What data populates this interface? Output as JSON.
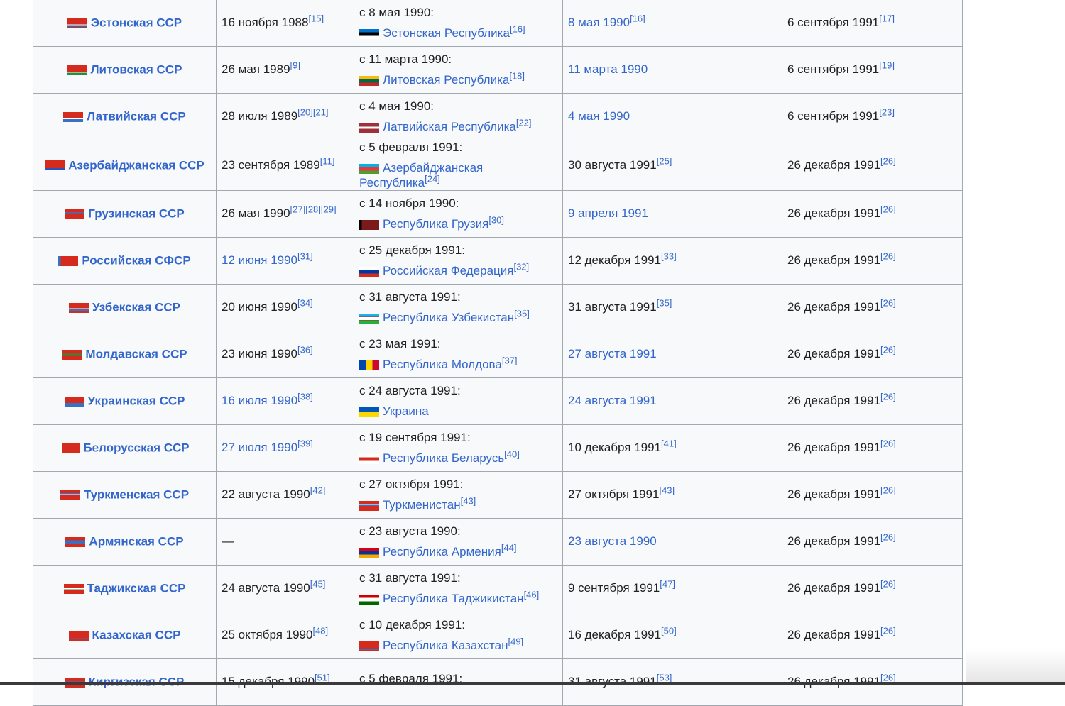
{
  "rows": [
    {
      "republic": "Эстонская ССР",
      "rep_flag": "estonian-ssr-flag",
      "sovereignty": "16 ноября 1988",
      "sov_refs": "[15]",
      "sov_link": false,
      "successor_since": "с 8 мая 1990:",
      "successor_name": "Эстонская Республика",
      "succ_refs": "[16]",
      "succ_flag": "estonia-flag",
      "independence": "8 мая 1990",
      "ind_refs": "[16]",
      "ind_link": true,
      "recognized": "6 сентября 1991",
      "rec_refs": "[17]"
    },
    {
      "republic": "Литовская ССР",
      "rep_flag": "lithuanian-ssr-flag",
      "sovereignty": "26 мая 1989",
      "sov_refs": "[9]",
      "sov_link": false,
      "successor_since": "с 11 марта 1990:",
      "successor_name": "Литовская Республика",
      "succ_refs": "[18]",
      "succ_flag": "lithuania-flag",
      "independence": "11 марта 1990",
      "ind_refs": "",
      "ind_link": true,
      "recognized": "6 сентября 1991",
      "rec_refs": "[19]"
    },
    {
      "republic": "Латвийская ССР",
      "rep_flag": "latvian-ssr-flag",
      "sovereignty": "28 июля 1989",
      "sov_refs": "[20][21]",
      "sov_link": false,
      "successor_since": "с 4 мая 1990:",
      "successor_name": "Латвийская Республика",
      "succ_refs": "[22]",
      "succ_flag": "latvia-flag",
      "independence": "4 мая 1990",
      "ind_refs": "",
      "ind_link": true,
      "recognized": "6 сентября 1991",
      "rec_refs": "[23]"
    },
    {
      "republic": "Азербайджанская ССР",
      "rep_flag": "azerbaijan-ssr-flag",
      "sovereignty": "23 сентября 1989",
      "sov_refs": "[11]",
      "sov_link": false,
      "successor_since": "с 5 февраля 1991:",
      "successor_name": "Азербайджанская Республика",
      "succ_refs": "[24]",
      "succ_flag": "azerbaijan-flag",
      "independence": "30 августа 1991",
      "ind_refs": "[25]",
      "ind_link": false,
      "recognized": "26 декабря 1991",
      "rec_refs": "[26]"
    },
    {
      "republic": "Грузинская ССР",
      "rep_flag": "georgian-ssr-flag",
      "sovereignty": "26 мая 1990",
      "sov_refs": "[27][28][29]",
      "sov_link": false,
      "successor_since": "с 14 ноября 1990:",
      "successor_name": "Республика Грузия",
      "succ_refs": "[30]",
      "succ_flag": "georgia-flag",
      "independence": "9 апреля 1991",
      "ind_refs": "",
      "ind_link": true,
      "recognized": "26 декабря 1991",
      "rec_refs": "[26]"
    },
    {
      "republic": "Российская СФСР",
      "rep_flag": "russian-sfsr-flag",
      "sovereignty": "12 июня 1990",
      "sov_refs": "[31]",
      "sov_link": true,
      "successor_since": "с 25 декабря 1991:",
      "successor_name": "Российская Федерация",
      "succ_refs": "[32]",
      "succ_flag": "russia-flag",
      "independence": "12 декабря 1991",
      "ind_refs": "[33]",
      "ind_link": false,
      "recognized": "26 декабря 1991",
      "rec_refs": "[26]"
    },
    {
      "republic": "Узбекская ССР",
      "rep_flag": "uzbek-ssr-flag",
      "sovereignty": "20 июня 1990",
      "sov_refs": "[34]",
      "sov_link": false,
      "successor_since": "с 31 августа 1991:",
      "successor_name": "Республика Узбекистан",
      "succ_refs": "[35]",
      "succ_flag": "uzbekistan-flag",
      "independence": "31 августа 1991",
      "ind_refs": "[35]",
      "ind_link": false,
      "recognized": "26 декабря 1991",
      "rec_refs": "[26]"
    },
    {
      "republic": "Молдавская ССР",
      "rep_flag": "moldavian-ssr-flag",
      "sovereignty": "23 июня 1990",
      "sov_refs": "[36]",
      "sov_link": false,
      "successor_since": "с 23 мая 1991:",
      "successor_name": "Республика Молдова",
      "succ_refs": "[37]",
      "succ_flag": "moldova-flag",
      "independence": "27 августа 1991",
      "ind_refs": "",
      "ind_link": true,
      "recognized": "26 декабря 1991",
      "rec_refs": "[26]"
    },
    {
      "republic": "Украинская ССР",
      "rep_flag": "ukrainian-ssr-flag",
      "sovereignty": "16 июля 1990",
      "sov_refs": "[38]",
      "sov_link": true,
      "successor_since": "с 24 августа 1991:",
      "successor_name": "Украина",
      "succ_refs": "",
      "succ_flag": "ukraine-flag",
      "independence": "24 августа 1991",
      "ind_refs": "",
      "ind_link": true,
      "recognized": "26 декабря 1991",
      "rec_refs": "[26]"
    },
    {
      "republic": "Белорусская ССР",
      "rep_flag": "byelorussian-ssr-flag",
      "sovereignty": "27 июля 1990",
      "sov_refs": "[39]",
      "sov_link": true,
      "successor_since": "с 19 сентября 1991:",
      "successor_name": "Республика Беларусь",
      "succ_refs": "[40]",
      "succ_flag": "belarus-flag",
      "independence": "10 декабря 1991",
      "ind_refs": "[41]",
      "ind_link": false,
      "recognized": "26 декабря 1991",
      "rec_refs": "[26]"
    },
    {
      "republic": "Туркменская ССР",
      "rep_flag": "turkmen-ssr-flag",
      "sovereignty": "22 августа 1990",
      "sov_refs": "[42]",
      "sov_link": false,
      "successor_since": "с 27 октября 1991:",
      "successor_name": "Туркменистан",
      "succ_refs": "[43]",
      "succ_flag": "turkmenistan-flag",
      "independence": "27 октября 1991",
      "ind_refs": "[43]",
      "ind_link": false,
      "recognized": "26 декабря 1991",
      "rec_refs": "[26]"
    },
    {
      "republic": "Армянская ССР",
      "rep_flag": "armenian-ssr-flag",
      "sovereignty": "—",
      "sov_refs": "",
      "sov_link": false,
      "successor_since": "с 23 августа 1990:",
      "successor_name": "Республика Армения",
      "succ_refs": "[44]",
      "succ_flag": "armenia-flag",
      "independence": "23 августа 1990",
      "ind_refs": "",
      "ind_link": true,
      "recognized": "26 декабря 1991",
      "rec_refs": "[26]"
    },
    {
      "republic": "Таджикская ССР",
      "rep_flag": "tajik-ssr-flag",
      "sovereignty": "24 августа 1990",
      "sov_refs": "[45]",
      "sov_link": false,
      "successor_since": "с 31 августа 1991:",
      "successor_name": "Республика Таджикистан",
      "succ_refs": "[46]",
      "succ_flag": "tajikistan-flag",
      "independence": "9 сентября 1991",
      "ind_refs": "[47]",
      "ind_link": false,
      "recognized": "26 декабря 1991",
      "rec_refs": "[26]"
    },
    {
      "republic": "Казахская ССР",
      "rep_flag": "kazakh-ssr-flag",
      "sovereignty": "25 октября 1990",
      "sov_refs": "[48]",
      "sov_link": false,
      "successor_since": "с 10 декабря 1991:",
      "successor_name": "Республика Казахстан",
      "succ_refs": "[49]",
      "succ_flag": "kazakhstan-flag",
      "independence": "16 декабря 1991",
      "ind_refs": "[50]",
      "ind_link": false,
      "recognized": "26 декабря 1991",
      "rec_refs": "[26]"
    },
    {
      "republic": "Киргизская ССР",
      "rep_flag": "kirghiz-ssr-flag",
      "sovereignty": "15 декабря 1990",
      "sov_refs": "[51]",
      "sov_link": false,
      "successor_since": "с 5 февраля 1991:",
      "successor_name": "",
      "succ_refs": "",
      "succ_flag": "",
      "independence": "31 августа 1991",
      "ind_refs": "[53]",
      "ind_link": false,
      "recognized": "26 декабря 1991",
      "rec_refs": "[26]"
    }
  ],
  "colors": {
    "link": "#3366cc",
    "text": "#202122",
    "cell_bg": "#f8f9fa",
    "border": "#a2a9b1"
  }
}
